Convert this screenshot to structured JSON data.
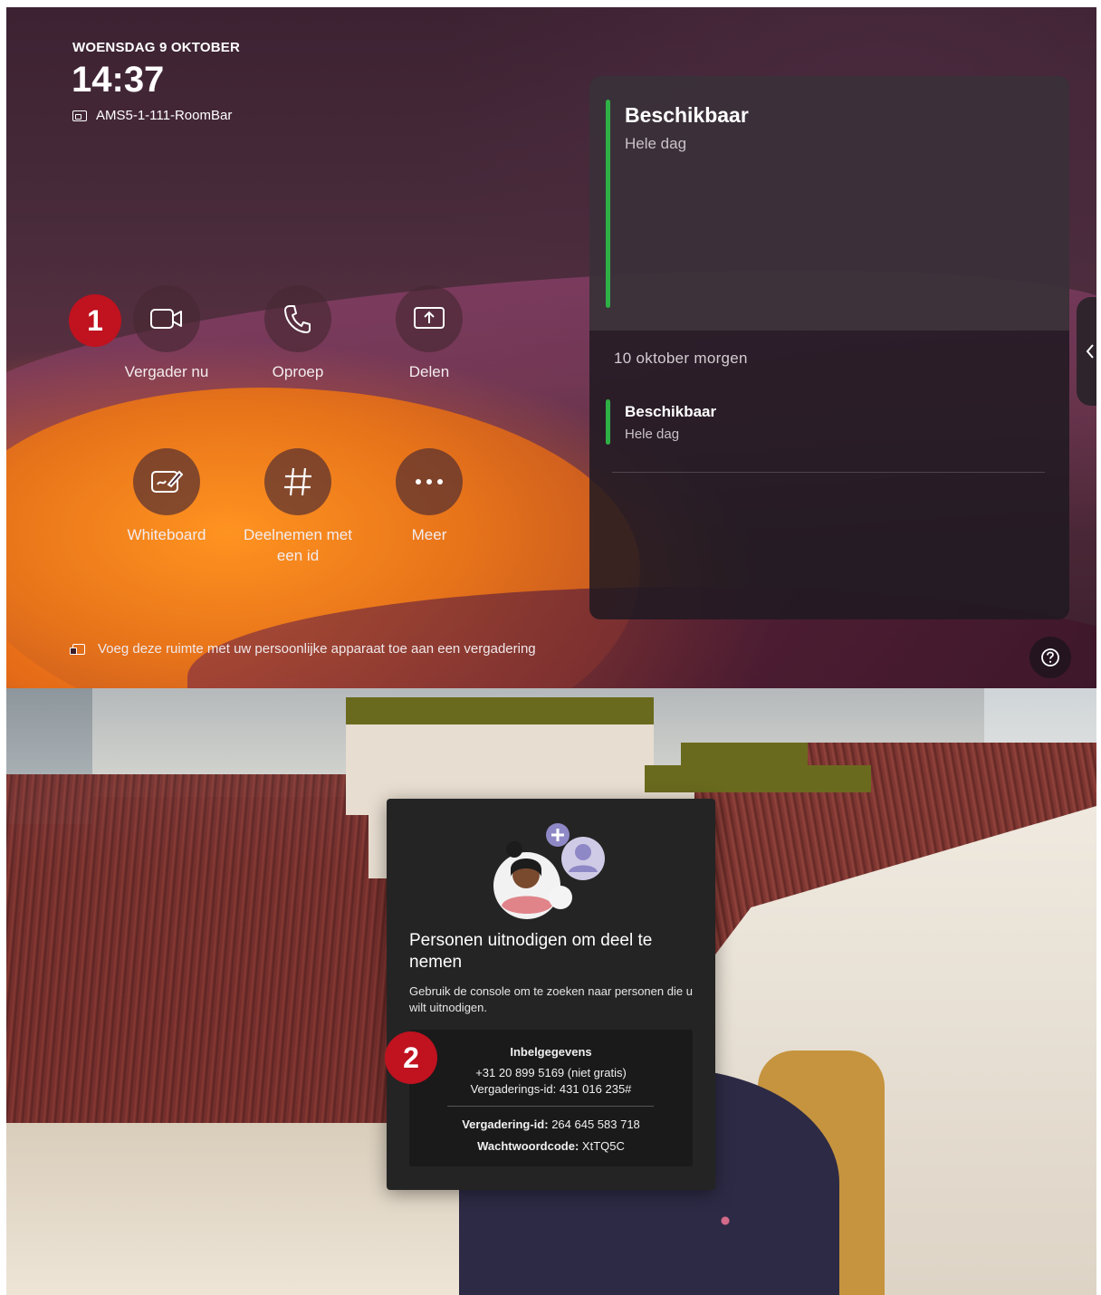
{
  "home": {
    "date": "WOENSDAG 9 OKTOBER",
    "time": "14:37",
    "device_name": "AMS5-1-111-RoomBar",
    "actions": [
      {
        "label": "Vergader nu",
        "icon": "video-camera-icon"
      },
      {
        "label": "Oproep",
        "icon": "phone-icon"
      },
      {
        "label": "Delen",
        "icon": "share-screen-icon"
      },
      {
        "label": "Whiteboard",
        "icon": "whiteboard-icon"
      },
      {
        "label": "Deelnemen met een id",
        "icon": "hash-icon"
      },
      {
        "label": "Meer",
        "icon": "more-icon"
      }
    ],
    "footer_note": "Voeg deze ruimte met uw persoonlijke apparaat toe aan een vergadering",
    "help_icon": "help-icon"
  },
  "calendar": {
    "current_title": "Beschikbaar",
    "current_subtitle": "Hele dag",
    "next_day_label": "10 oktober morgen",
    "next_title": "Beschikbaar",
    "next_subtitle": "Hele dag",
    "status_color": "#2fb046"
  },
  "badges": {
    "one": "1",
    "two": "2",
    "color": "#c0121f"
  },
  "invite": {
    "title": "Personen uitnodigen om deel te nemen",
    "description": "Gebruik de console om te zoeken naar personen die u wilt uitnodigen.",
    "dial_heading": "Inbelgegevens",
    "dial_number": "+31 20 899 5169 (niet gratis)",
    "dial_meeting_id": "Vergaderings-id:  431 016 235#",
    "meeting_id_label": "Vergadering-id:",
    "meeting_id_value": "264 645 583 718",
    "passcode_label": "Wachtwoordcode:",
    "passcode_value": "XtTQ5C"
  }
}
